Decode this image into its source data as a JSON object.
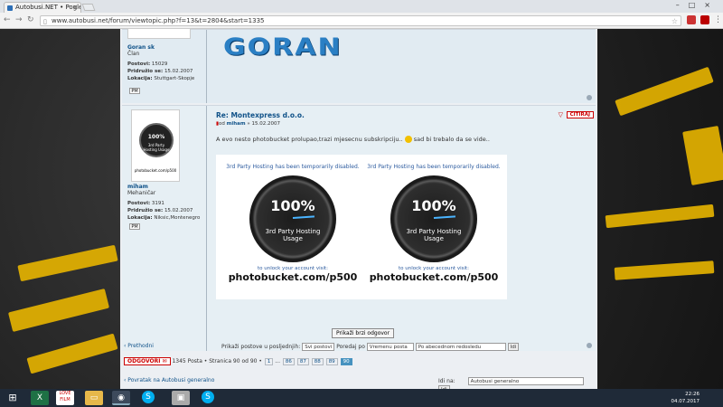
{
  "browser": {
    "tab_title": "Autobusi.NET • Pogleda",
    "url": "www.autobusi.net/forum/viewtopic.php?f=13&t=2804&start=1335"
  },
  "post1": {
    "username": "Goran sk",
    "rank": "Član",
    "posts_label": "Postovi:",
    "posts": "15029",
    "joined_label": "Pridružio se:",
    "joined": "15.02.2007",
    "location_label": "Lokacija:",
    "location": "Stuttgart-Skopje",
    "signature_logo": "GORAN"
  },
  "post2": {
    "avatar_pct": "100%",
    "avatar_text": "3rd Party Hosting Usage",
    "avatar_caption": "photobucket.com/p500",
    "username": "miham",
    "rank": "Mehaničar",
    "posts_label": "Postovi:",
    "posts": "3191",
    "joined_label": "Pridružio se:",
    "joined": "15.02.2007",
    "location_label": "Lokacija:",
    "location": "Niksic,Montenegro",
    "title": "Re: Montexpress d.o.o.",
    "by_prefix": "od",
    "by_user": "miham",
    "by_date": "» 15.02.2007",
    "quote_label": "CITIRAJ",
    "text_before": "A evo nesto photobucket prolupao,trazi mjesecnu subskripciju..",
    "text_after": "sad bi trebalo da se vide..",
    "gauges": [
      {
        "caption": "3rd Party Hosting has been temporarily disabled.",
        "pct": "100%",
        "label1": "3rd Party Hosting",
        "label2": "Usage",
        "unlock": "to unlock your account visit:",
        "link": "photobucket.com/p500"
      },
      {
        "caption": "3rd Party Hosting has been temporarily disabled.",
        "pct": "100%",
        "label1": "3rd Party Hosting",
        "label2": "Usage",
        "unlock": "to unlock your account visit:",
        "link": "photobucket.com/p500"
      }
    ]
  },
  "controls": {
    "quick_reply": "Prikaži brzi odgovor",
    "prev": "‹ Prethodni",
    "show_label": "Prikaži postove u posljednjih:",
    "show_value": "Svi postovi",
    "sort_label": "Poredaj po",
    "sort_value": "Vremenu posta",
    "order_value": "Po abecednom redosledu",
    "go": "Idi",
    "reply": "ODGOVORI",
    "summary": "1345 Posta • Stranica 90 od 90 •",
    "pages": [
      "1",
      "...",
      "86",
      "87",
      "88",
      "89",
      "90"
    ],
    "back": "‹ Povratak na Autobusi generalno",
    "jump_label": "Idi na:",
    "jump_value": "Autobusi generalno",
    "jump_go": "Idi"
  },
  "taskbar": {
    "time": "22:26",
    "date": "04.07.2017"
  }
}
